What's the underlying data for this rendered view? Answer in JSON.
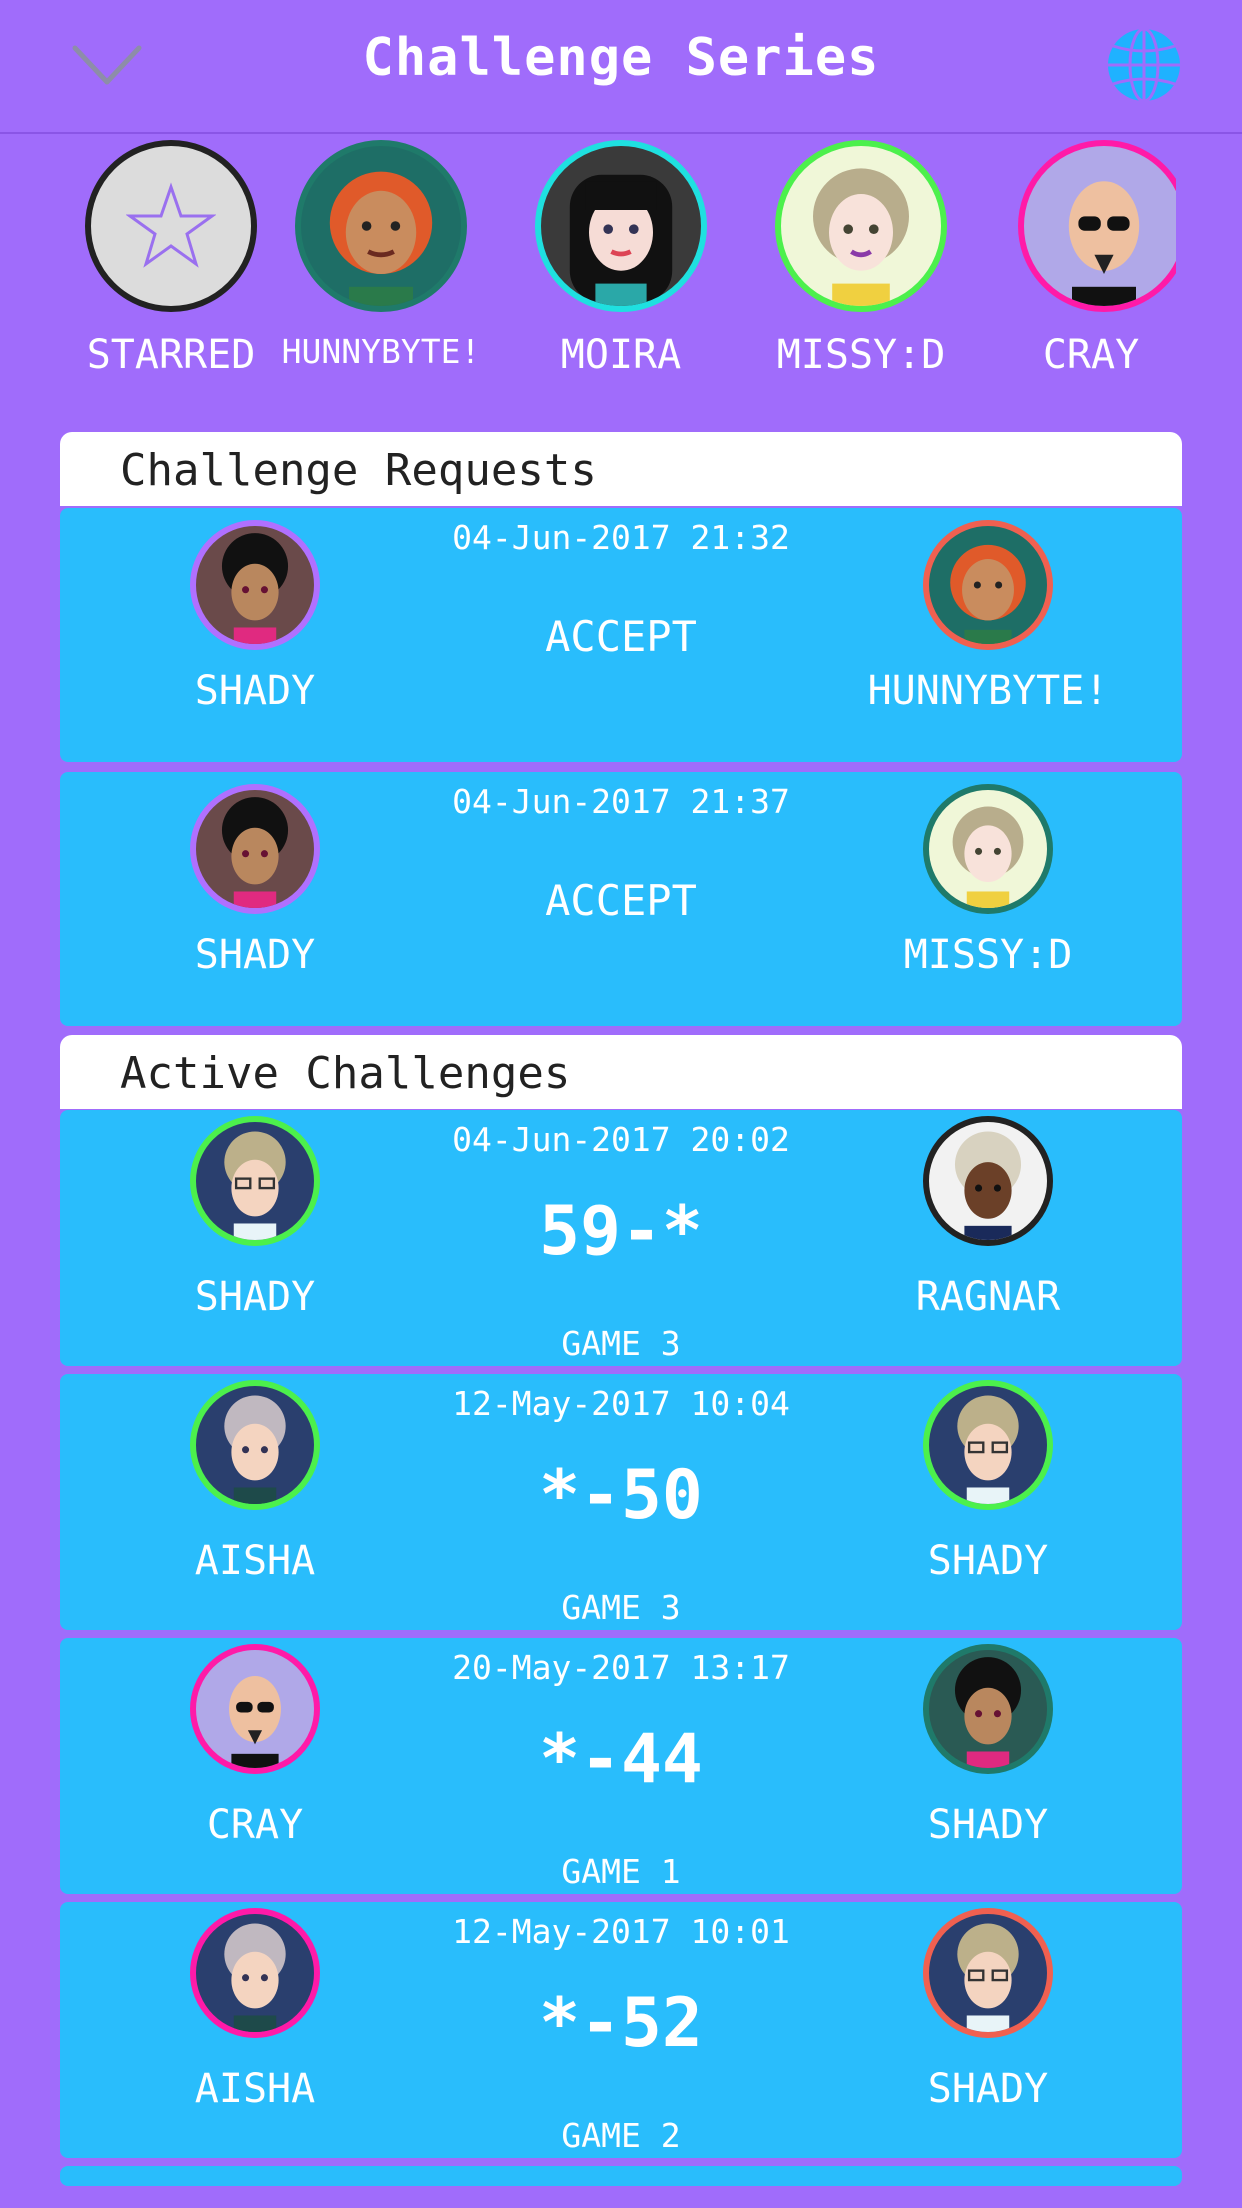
{
  "header": {
    "title": "Challenge Series",
    "back_icon": "chevron-down-icon",
    "globe_icon": "globe-icon"
  },
  "friends": [
    {
      "label": "STARRED",
      "icon": "star-icon",
      "ring": "#222222"
    },
    {
      "label": "HUNNYBYTE!",
      "ring": "#1f7a6a"
    },
    {
      "label": "MOIRA",
      "ring": "#1fe0e0"
    },
    {
      "label": "MISSY:D",
      "ring": "#4cf04c"
    },
    {
      "label": "CRAY",
      "ring": "#ff1aa8"
    }
  ],
  "requests": {
    "heading": "Challenge Requests",
    "items": [
      {
        "date": "04-Jun-2017 21:32",
        "action": "ACCEPT",
        "left": {
          "name": "SHADY",
          "ring": "#b070ff"
        },
        "right": {
          "name": "HUNNYBYTE!",
          "ring": "#f06050"
        }
      },
      {
        "date": "04-Jun-2017 21:37",
        "action": "ACCEPT",
        "left": {
          "name": "SHADY",
          "ring": "#b070ff"
        },
        "right": {
          "name": "MISSY:D",
          "ring": "#1f7a6a"
        }
      }
    ]
  },
  "active": {
    "heading": "Active Challenges",
    "items": [
      {
        "date": "04-Jun-2017 20:02",
        "score": "59-*",
        "game": "GAME 3",
        "left": {
          "name": "SHADY",
          "ring": "#4cf04c"
        },
        "right": {
          "name": "RAGNAR",
          "ring": "#222222"
        }
      },
      {
        "date": "12-May-2017 10:04",
        "score": "*-50",
        "game": "GAME 3",
        "left": {
          "name": "AISHA",
          "ring": "#4cf04c"
        },
        "right": {
          "name": "SHADY",
          "ring": "#4cf04c"
        }
      },
      {
        "date": "20-May-2017 13:17",
        "score": "*-44",
        "game": "GAME 1",
        "left": {
          "name": "CRAY",
          "ring": "#ff1aa8"
        },
        "right": {
          "name": "SHADY",
          "ring": "#1f7a6a"
        }
      },
      {
        "date": "12-May-2017 10:01",
        "score": "*-52",
        "game": "GAME 2",
        "left": {
          "name": "AISHA",
          "ring": "#ff1aa8"
        },
        "right": {
          "name": "SHADY",
          "ring": "#f06050"
        }
      }
    ]
  },
  "colors": {
    "background": "#a06cfb",
    "card": "#29bdfc",
    "accent_icon": "#1fb2ff"
  }
}
